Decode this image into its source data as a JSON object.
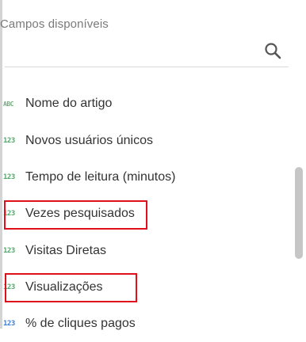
{
  "panel": {
    "title": "Campos disponíveis",
    "search": {
      "value": "",
      "placeholder": "",
      "icon": "search-icon"
    }
  },
  "fields": [
    {
      "type_badge": "ABC",
      "type": "text",
      "label": "Nome do artigo",
      "highlighted": false
    },
    {
      "type_badge": "123",
      "type": "number",
      "label": "Novos usuários únicos",
      "highlighted": false
    },
    {
      "type_badge": "123",
      "type": "number",
      "label": "Tempo de leitura (minutos)",
      "highlighted": false
    },
    {
      "type_badge": "123",
      "type": "number",
      "label": "Vezes pesquisados",
      "highlighted": true
    },
    {
      "type_badge": "123",
      "type": "number",
      "label": "Visitas Diretas",
      "highlighted": false
    },
    {
      "type_badge": "123",
      "type": "number",
      "label": "Visualizações",
      "highlighted": true
    },
    {
      "type_badge": "123",
      "type": "number",
      "label": "% de cliques pagos",
      "highlighted": false
    }
  ],
  "colors": {
    "highlight_border": "#e0101a",
    "text_badge": "#6fae7c",
    "number_badge": "#55a86c",
    "number_badge_blue": "#3d7fd6"
  }
}
